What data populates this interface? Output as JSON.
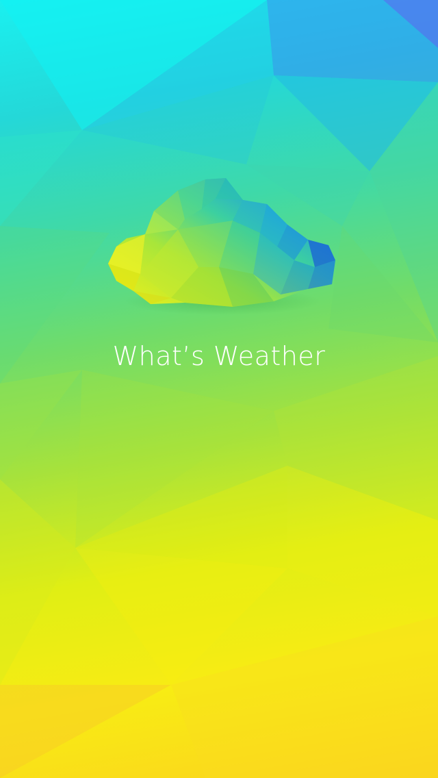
{
  "app": {
    "title": "What’s Weather"
  },
  "splash": {
    "logo_icon": "cloud-icon"
  },
  "colors": {
    "top_cyan": "#1af0f0",
    "mid_green": "#a6e23c",
    "bottom_yellow": "#fbd21e",
    "title_text": "#ffffff"
  }
}
